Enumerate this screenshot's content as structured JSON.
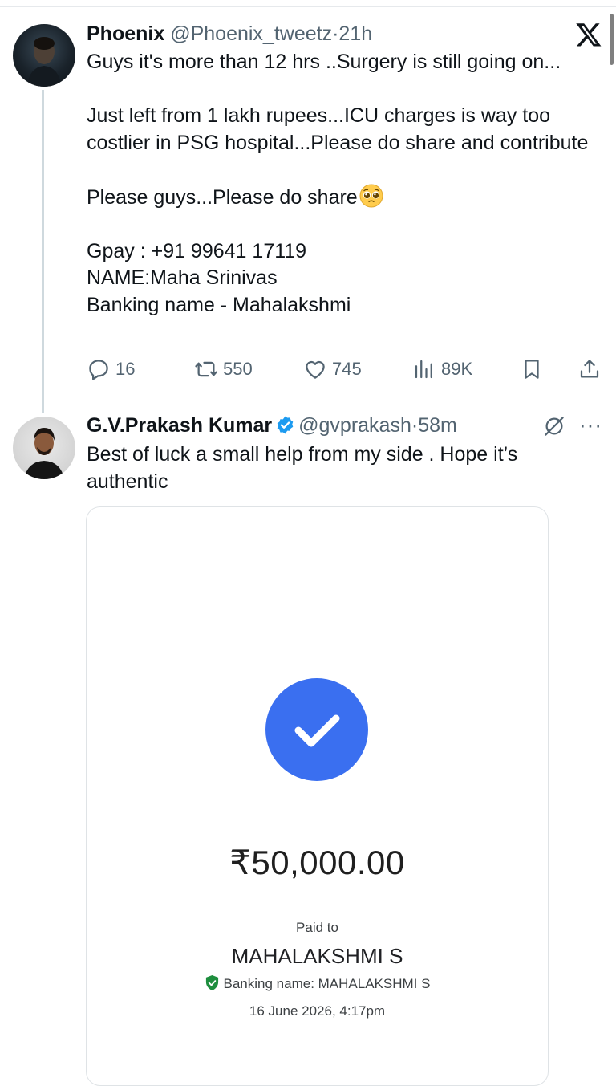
{
  "tweet1": {
    "name": "Phoenix",
    "handle": "@Phoenix_tweetz",
    "separator": "·",
    "time": "21h",
    "line1": "Guys it's more than 12 hrs ..Surgery is still going on...",
    "para2": "Just left from 1 lakh rupees...ICU charges is way too costlier in PSG hospital...Please do share and contribute",
    "para3": "Please guys...Please do share",
    "emoji": "pleading-face-emoji",
    "gpay": "Gpay : +91 99641 17119",
    "name_line": "NAME:Maha Srinivas",
    "banking_line": "Banking name - Mahalakshmi",
    "replies": "16",
    "retweets": "550",
    "likes": "745",
    "views": "89K"
  },
  "tweet2": {
    "name": "G.V.Prakash Kumar",
    "verified": true,
    "handle": "@gvprakash",
    "separator": "·",
    "time": "58m",
    "text": "Best of luck a small help from my side . Hope it’s authentic",
    "more_label": "···"
  },
  "payment_card": {
    "amount": "₹50,000.00",
    "paid_to_label": "Paid to",
    "payee": "MAHALAKSHMI S",
    "banking_name": "Banking name: MAHALAKSHMI S",
    "date": "16 June 2026, 4:17pm"
  },
  "colors": {
    "text": "#0f1419",
    "secondary": "#536471",
    "verified_blue": "#1d9bf0",
    "check_blue": "#3a6ff0",
    "shield_green": "#1e8e3e"
  }
}
